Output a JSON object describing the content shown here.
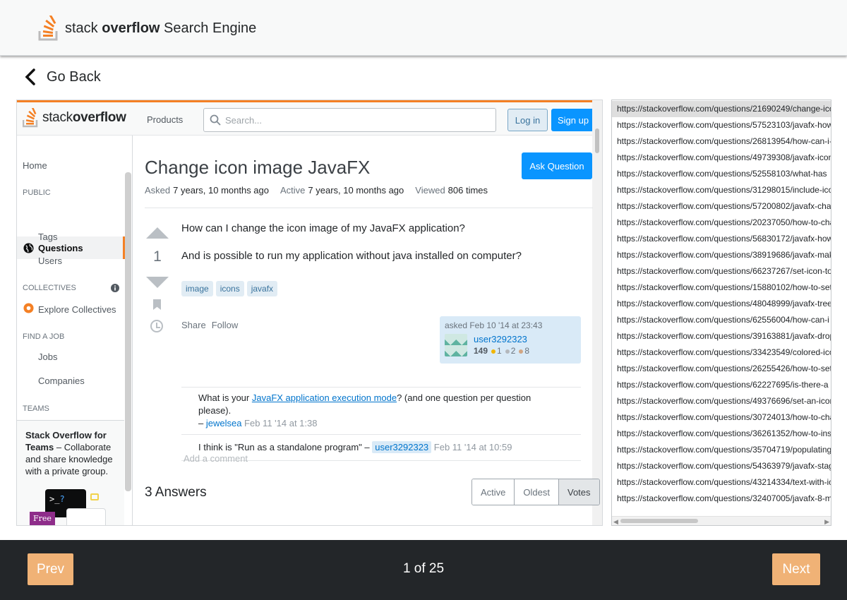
{
  "app": {
    "logo_light": "stack ",
    "logo_bold": "overflow",
    "logo_suffix": " Search Engine",
    "go_back_label": "Go Back"
  },
  "so": {
    "logo_light": "stack",
    "logo_bold": "overflow",
    "products_label": "Products",
    "search_placeholder": "Search...",
    "login_label": "Log in",
    "signup_label": "Sign up"
  },
  "sidebar": {
    "home": "Home",
    "public_section": "PUBLIC",
    "questions": "Questions",
    "tags": "Tags",
    "users": "Users",
    "collectives_section": "COLLECTIVES",
    "explore_collectives": "Explore Collectives",
    "find_job_section": "FIND A JOB",
    "jobs": "Jobs",
    "companies": "Companies",
    "teams_section": "TEAMS",
    "teams_title": "Stack Overflow for Teams",
    "teams_text": " – Collaborate and share knowledge with a private group.",
    "free_badge": "Free"
  },
  "question": {
    "title": "Change icon image JavaFX",
    "ask_button": "Ask Question",
    "asked_key": "Asked",
    "asked_val": "7 years, 10 months ago",
    "active_key": "Active",
    "active_val": "7 years, 10 months ago",
    "viewed_key": "Viewed",
    "viewed_val": "806 times",
    "votes": "1",
    "body_1": "How can I change the icon image of my JavaFX application?",
    "body_2": "And is possible to run my application without java installed on computer?",
    "tags": [
      "image",
      "icons",
      "javafx"
    ],
    "share_label": "Share",
    "follow_label": "Follow",
    "asked_line": "asked Feb 10 '14 at 23:43",
    "user_name": "user3292323",
    "user_rep": "149",
    "gold": "1",
    "silver": "2",
    "bronze": "8",
    "badge_colors": {
      "gold": "#f1b600",
      "silver": "#b4b8bc",
      "bronze": "#d1a684"
    }
  },
  "comments": [
    {
      "pre": "What is your ",
      "link": "JavaFX application execution mode",
      "post": "? (and one question per question please).",
      "dash": "– ",
      "user": "jewelsea",
      "date": " Feb 11 '14 at 1:38"
    },
    {
      "text": "I think is \"Run as a standalone program\" – ",
      "user": "user3292323",
      "date": " Feb 11 '14 at 10:59"
    }
  ],
  "add_comment": "Add a comment",
  "answers_count": "3 Answers",
  "sort_options": [
    "Active",
    "Oldest",
    "Votes"
  ],
  "urls": [
    "https://stackoverflow.com/questions/21690249/change-icon-image-javafx",
    "https://stackoverflow.com/questions/57523103/javafx-how-to",
    "https://stackoverflow.com/questions/26813954/how-can-i-change",
    "https://stackoverflow.com/questions/49739308/javafx-icon",
    "https://stackoverflow.com/questions/52558103/what-has",
    "https://stackoverflow.com/questions/31298015/include-icon",
    "https://stackoverflow.com/questions/57200802/javafx-change",
    "https://stackoverflow.com/questions/20237050/how-to-change",
    "https://stackoverflow.com/questions/56830172/javafx-how",
    "https://stackoverflow.com/questions/38919686/javafx-make",
    "https://stackoverflow.com/questions/66237267/set-icon-to",
    "https://stackoverflow.com/questions/15880102/how-to-set",
    "https://stackoverflow.com/questions/48048999/javafx-tree",
    "https://stackoverflow.com/questions/62556004/how-can-i",
    "https://stackoverflow.com/questions/39163881/javafx-drop",
    "https://stackoverflow.com/questions/33423549/colored-icon",
    "https://stackoverflow.com/questions/26255426/how-to-set",
    "https://stackoverflow.com/questions/62227695/is-there-a",
    "https://stackoverflow.com/questions/49376696/set-an-icon",
    "https://stackoverflow.com/questions/30724013/how-to-change",
    "https://stackoverflow.com/questions/36261352/how-to-insert",
    "https://stackoverflow.com/questions/35704719/populating",
    "https://stackoverflow.com/questions/54363979/javafx-stage",
    "https://stackoverflow.com/questions/43214334/text-with-icon",
    "https://stackoverflow.com/questions/32407005/javafx-8-menu"
  ],
  "footer": {
    "prev_label": "Prev",
    "next_label": "Next",
    "page_indicator": "1 of 25"
  },
  "colors": {
    "so_orange": "#f48024",
    "so_blue": "#0a95ff",
    "footer_bg": "#232629",
    "nav_button": "#f0b276"
  }
}
